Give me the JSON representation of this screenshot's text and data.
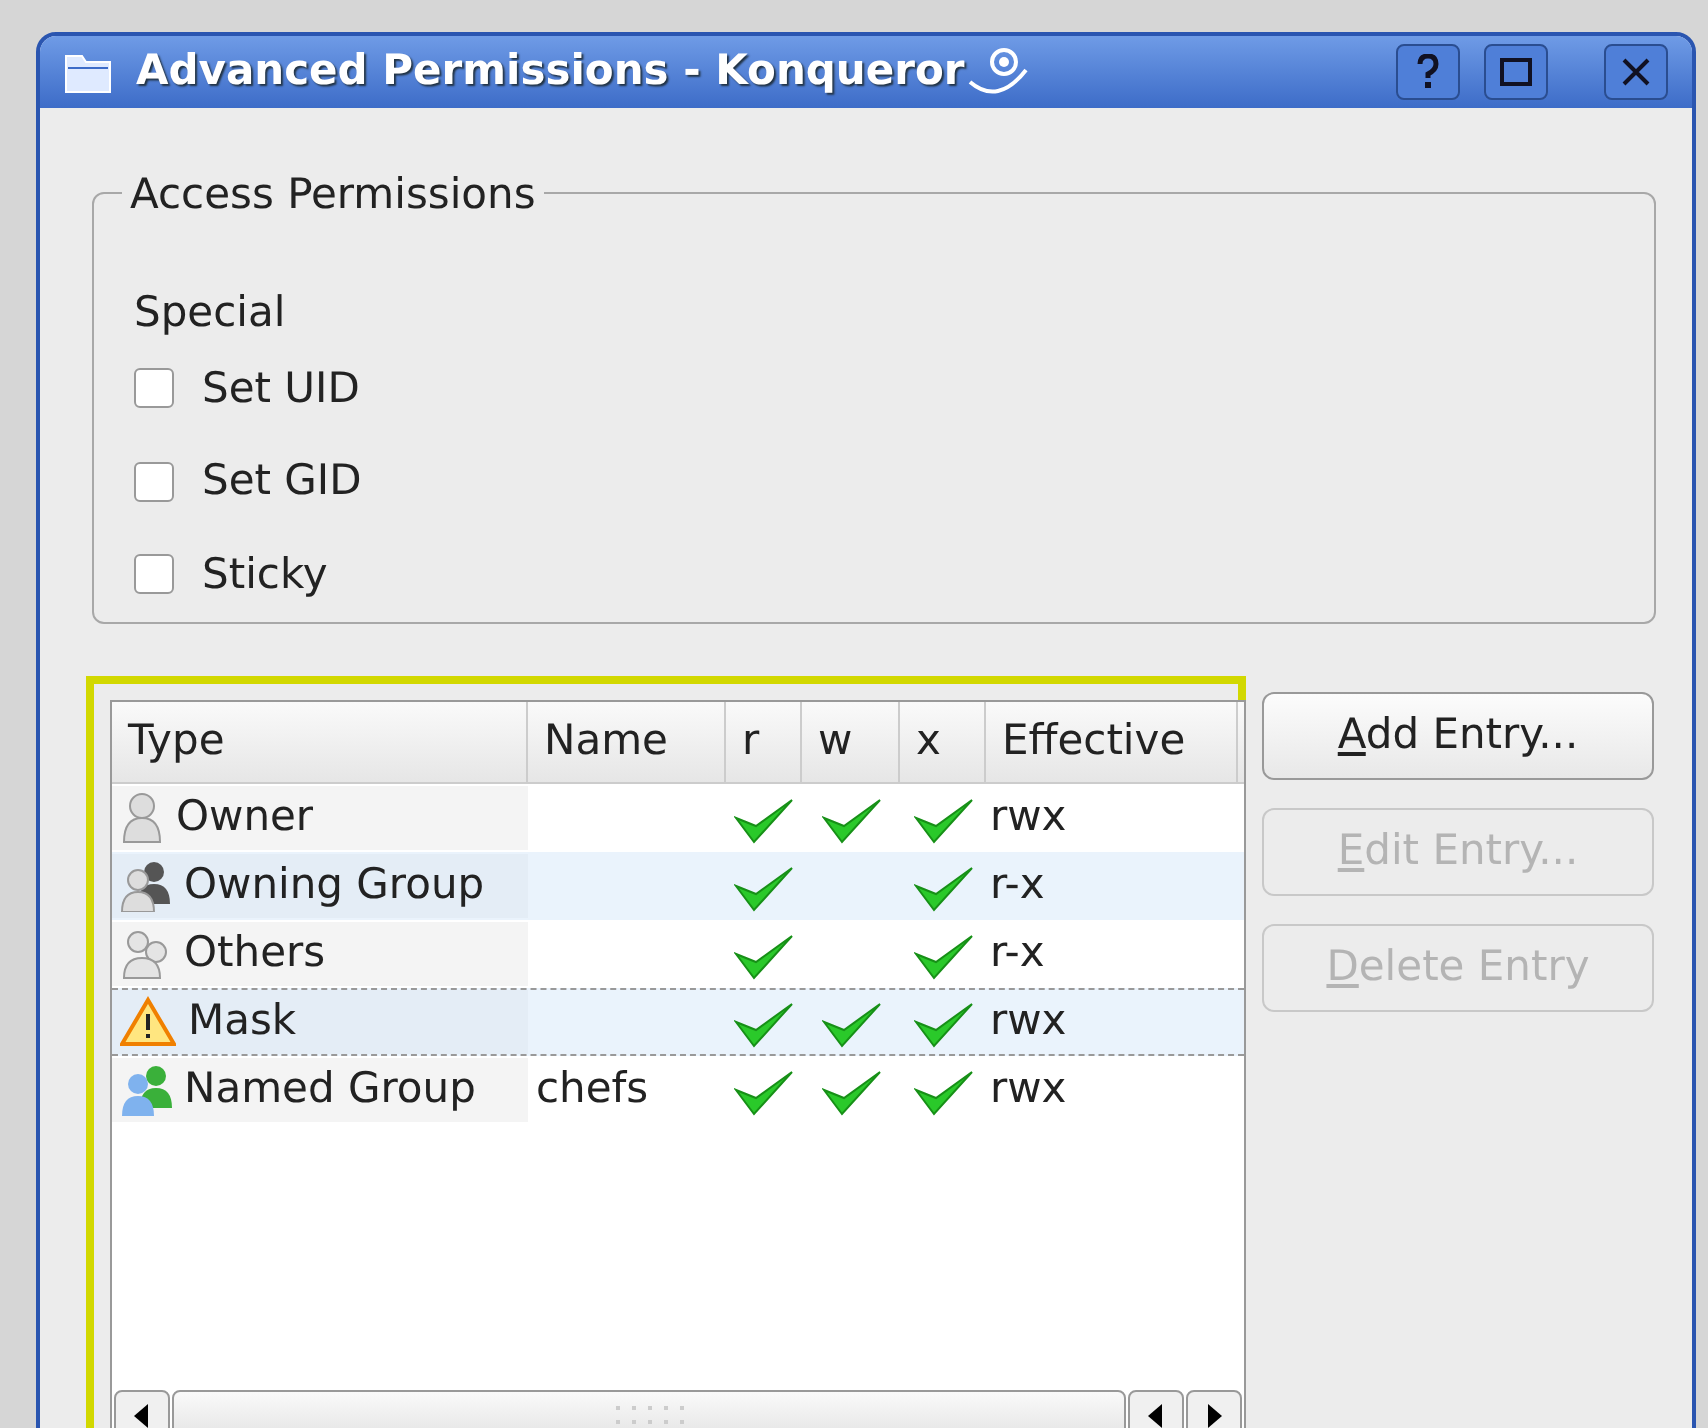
{
  "window": {
    "title": "Advanced Permissions - Konqueror"
  },
  "access_permissions": {
    "title": "Access Permissions",
    "special_label": "Special",
    "flags": [
      {
        "label": "Set UID",
        "checked": false
      },
      {
        "label": "Set GID",
        "checked": false
      },
      {
        "label": "Sticky",
        "checked": false
      }
    ]
  },
  "table": {
    "columns": [
      "Type",
      "Name",
      "r",
      "w",
      "x",
      "Effective"
    ],
    "rows": [
      {
        "kind": "owner",
        "type": "Owner",
        "r": true,
        "w": true,
        "x": true,
        "effective": "rwx",
        "focused": false
      },
      {
        "kind": "owning_group",
        "type": "Owning Group",
        "r": true,
        "w": false,
        "x": true,
        "effective": "r-x",
        "focused": false
      },
      {
        "kind": "others",
        "type": "Others",
        "r": true,
        "w": false,
        "x": true,
        "effective": "r-x",
        "focused": false
      },
      {
        "kind": "mask",
        "type": "Mask",
        "r": true,
        "w": true,
        "x": true,
        "effective": "rwx",
        "focused": true
      },
      {
        "kind": "named_group",
        "type": "Named Group",
        "name": "chefs",
        "r": true,
        "w": true,
        "x": true,
        "effective": "rwx",
        "focused": false
      }
    ]
  },
  "buttons": [
    {
      "label": "Add Entry...",
      "disabled": false
    },
    {
      "label": "Edit Entry...",
      "disabled": true
    },
    {
      "label": "Delete Entry",
      "disabled": true
    }
  ]
}
